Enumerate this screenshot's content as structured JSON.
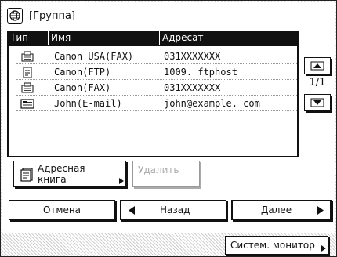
{
  "title": "[Группа]",
  "icons": {
    "title": "globe-icon",
    "address_book": "address-book-icon",
    "fax": "fax-icon",
    "ftp": "ftp-server-icon",
    "email": "email-icon"
  },
  "table": {
    "headers": [
      "Тип",
      "Имя",
      "Адресат"
    ],
    "rows": [
      {
        "type": "fax",
        "name": "Canon USA(FAX)",
        "address": "031XXXXXXX"
      },
      {
        "type": "ftp",
        "name": "Canon(FTP)",
        "address": "1009. ftphost"
      },
      {
        "type": "fax",
        "name": "Canon(FAX)",
        "address": "031XXXXXXX"
      },
      {
        "type": "email",
        "name": "John(E-mail)",
        "address": "john@example. com"
      }
    ]
  },
  "pager": {
    "label": "1/1"
  },
  "buttons": {
    "address_book": "Адресная книга",
    "delete": "Удалить",
    "cancel": "Отмена",
    "back": "Назад",
    "next": "Далее",
    "system_monitor": "Систем. монитор"
  }
}
